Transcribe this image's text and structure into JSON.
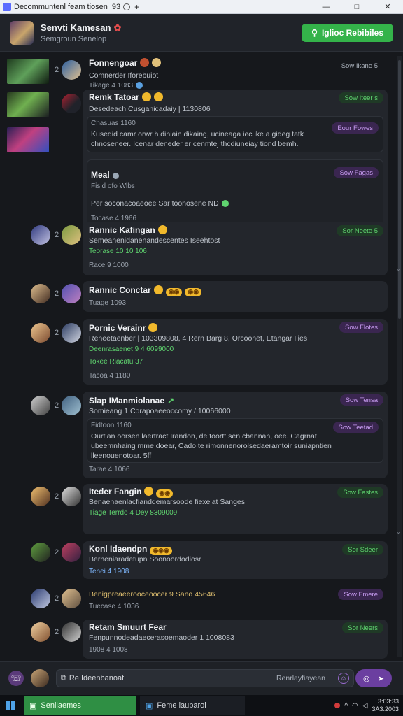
{
  "window": {
    "title": "Decommuntenl feam tiosen",
    "tab_count": "93",
    "plus": "+",
    "controls": [
      "—",
      "□",
      "✕"
    ]
  },
  "header": {
    "name": "Senvti Kamesan",
    "subtitle": "Semgroun Senelop",
    "join_label": "Iglioc Rebibiles"
  },
  "feed": [
    {
      "num": "2",
      "name": "Fonnengoar",
      "line": "Comnerder Iforebuiot",
      "meta": "Tikage 4 1083",
      "badge": "Sow Ikane 5"
    },
    {
      "num": "",
      "name": "Remk Tatoar",
      "line": "Desedeach Cusganicadaiy | 1130806",
      "meta": "",
      "badge": "Sow Iteer s",
      "inner_top": "Chasuas 1160",
      "inner_body": "Kusedid camr orwr h diniain dikaing, ucineaga iec ike a gideg tatk chnoseneer. Icenar deneder er cenmtej thcdiuneiay tiond bemh.",
      "inner_badge": "Eour Fowes",
      "sub_name": "Meal",
      "sub_line1": "Fisid ofo Wlbs",
      "sub_line2": "Per soconacoaeoee Sar toonosene ND",
      "sub_meta": "Tocase 4 1966",
      "sub_badge": "Sow Fagas"
    },
    {
      "num": "2",
      "name": "Rannic Kafingan",
      "line": "Semeanenidanenandescentes Iseehtost",
      "meta1": "Teorase 10 10 106",
      "meta2": "Race 9 1000",
      "badge": "Sor Neete 5"
    },
    {
      "num": "2",
      "name": "Rannic Conctar",
      "line": "",
      "meta": "Tuage 1093",
      "badge": ""
    },
    {
      "num": "2",
      "name": "Pornic Verainr",
      "line": "Reneetaenber | 103309808, 4 Rern Barg 8, Orcoonet, Etangar Ilies",
      "meta1": "Deenrasaenet 9 4 6099000",
      "meta2": "Tokee Riacatu 37",
      "meta3": "Tacoa 4 1180",
      "badge": "Sow Flotes"
    },
    {
      "num": "2",
      "name": "Slap IManmiolanae",
      "line": "Somieang 1 Corapoaeeoccomy / 10066000",
      "meta": "",
      "badge": "Sow Tensa",
      "inner_top": "Fidtoon 1160",
      "inner_body": "Ourtian oorsen laertract Irandon, de toortt sen cbannan, oee. Cagrnat ubeemnhaing mme doear, Cado te rimonnenorolsedaeramtoir suniapntien lleenouenotoar. 5ff",
      "inner_badge": "Sow Teetad",
      "meta2": "Tarae 4 1066"
    },
    {
      "num": "2",
      "name": "Iteder Fangin",
      "line": "Benaenaenlacfianddemarsoode fiexeiat Sanges",
      "meta": "Tiage Terrdo 4 Dey 8309009",
      "badge": "Sow Fastes"
    },
    {
      "num": "2",
      "name": "Konl Idaendpn",
      "line": "Berneniaradetupn Soonoordodiosr",
      "meta": "Tenei 4 1908",
      "badge": "Sor Sdeer"
    },
    {
      "num": "2",
      "name": "",
      "line": "Benigpreaeerooceoocer 9 Sano 45646",
      "meta": "Tuecase 4 1036",
      "badge": "Sow Fmere"
    },
    {
      "num": "2",
      "name": "Retam Smuurt Fear",
      "line": "Fenpunnodeadaecerasoemaoder 1 1008083",
      "meta": "1908 4 1008",
      "badge": "Sor Neers"
    }
  ],
  "composer": {
    "placeholder": "Re Ideenbanoat",
    "side_text": "Renrlayfiayean"
  },
  "taskbar": {
    "app1": "Senilaemes",
    "app2": "Feme laubaroi",
    "time": "3:03:33",
    "date": "3A3.2003"
  },
  "colors": {
    "accent_green": "#34b34a",
    "accent_purple": "#6b3fa0",
    "background": "#16181c"
  }
}
